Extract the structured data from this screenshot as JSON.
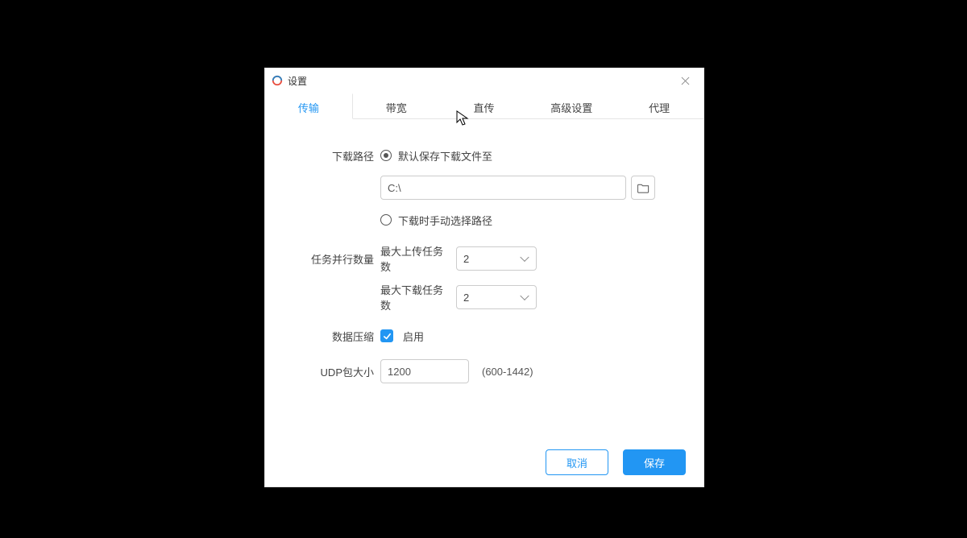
{
  "window": {
    "title": "设置"
  },
  "tabs": {
    "transfer": "传输",
    "bandwidth": "带宽",
    "direct": "直传",
    "advanced": "高级设置",
    "proxy": "代理"
  },
  "labels": {
    "download_path": "下载路径",
    "parallel_tasks": "任务并行数量",
    "max_upload": "最大上传任务数",
    "max_download": "最大下载任务数",
    "data_compression": "数据压缩",
    "udp_size": "UDP包大小"
  },
  "download_path": {
    "option_default": "默认保存下载文件至",
    "option_manual": "下载时手动选择路径",
    "value": "C:\\"
  },
  "parallel": {
    "upload_value": "2",
    "download_value": "2"
  },
  "compression": {
    "enabled_label": "启用"
  },
  "udp": {
    "value": "1200",
    "hint": "(600-1442)"
  },
  "buttons": {
    "cancel": "取消",
    "save": "保存"
  }
}
